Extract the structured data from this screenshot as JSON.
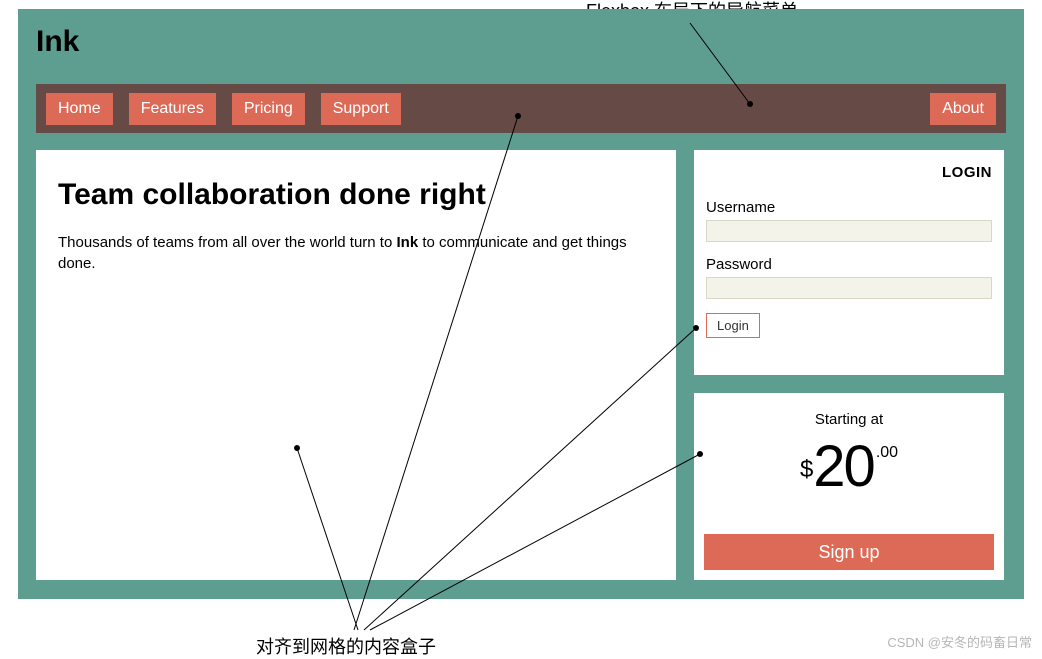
{
  "annotations": {
    "top": "Flexbox 布局下的导航菜单",
    "bottom": "对齐到网格的内容盒子",
    "watermark": "CSDN @安冬的码畜日常"
  },
  "header": {
    "logo": "Ink"
  },
  "nav": {
    "items": [
      "Home",
      "Features",
      "Pricing",
      "Support"
    ],
    "right": "About"
  },
  "hero": {
    "title": "Team collaboration done right",
    "lead_pre": "Thousands of teams from all over the world turn to ",
    "lead_brand": "Ink",
    "lead_post": " to communicate and get things done."
  },
  "login": {
    "title": "LOGIN",
    "username_label": "Username",
    "password_label": "Password",
    "button": "Login"
  },
  "pricing": {
    "starting": "Starting at",
    "currency": "$",
    "amount": "20",
    "cents": ".00",
    "signup": "Sign up"
  }
}
